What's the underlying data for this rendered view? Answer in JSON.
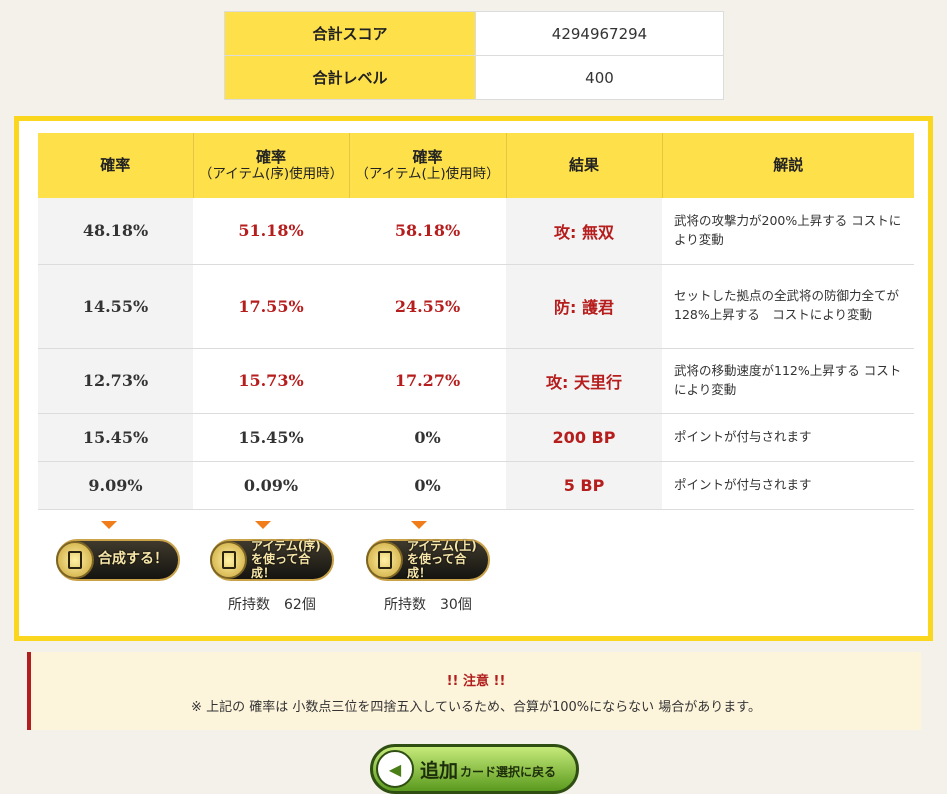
{
  "summary": {
    "rows": [
      {
        "label": "合計スコア",
        "value": "4294967294"
      },
      {
        "label": "合計レベル",
        "value": "400"
      }
    ]
  },
  "table": {
    "headers": {
      "base": "確率",
      "item_low": "確率",
      "item_low_sub": "（アイテム(序)使用時）",
      "item_high": "確率",
      "item_high_sub": "（アイテム(上)使用時）",
      "result": "結果",
      "desc": "解説"
    },
    "rows": [
      {
        "base": "48.18%",
        "low": "51.18%",
        "high": "58.18%",
        "result": "攻: 無双",
        "desc": "武将の攻撃力が200%上昇する コストにより変動"
      },
      {
        "base": "14.55%",
        "low": "17.55%",
        "high": "24.55%",
        "result": "防: 護君",
        "desc": "セットした拠点の全武将の防御力全てが128%上昇する　コストにより変動"
      },
      {
        "base": "12.73%",
        "low": "15.73%",
        "high": "17.27%",
        "result": "攻: 天里行",
        "desc": "武将の移動速度が112%上昇する コストにより変動"
      },
      {
        "base": "15.45%",
        "low": "15.45%",
        "high": "0%",
        "result": "200 BP",
        "desc": "ポイントが付与されます"
      },
      {
        "base": "9.09%",
        "low": "0.09%",
        "high": "0%",
        "result": "5 BP",
        "desc": "ポイントが付与されます"
      }
    ]
  },
  "buttons": {
    "fuse": "合成する！",
    "item_low_l1": "アイテム(序)",
    "item_low_l2": "を使って合成！",
    "item_high_l1": "アイテム(上)",
    "item_high_l2": "を使って合成！",
    "owned_low": "所持数　62個",
    "owned_high": "所持数　30個"
  },
  "notice": {
    "title": "!! 注意 !!",
    "message": "※ 上記の 確率は 小数点三位を四捨五入しているため、合算が100%にならない 場合があります。"
  },
  "back": {
    "label_big": "追加",
    "label_small": "カード選択に戻る"
  },
  "colors": {
    "accent_yellow": "#fee14a",
    "border_yellow": "#fbd61f",
    "result_red": "#b61d1d",
    "notice_red": "#b11e1e"
  },
  "icons": [
    "card-icon",
    "item-card-icon",
    "back-arrow-icon",
    "dropdown-arrow-icon"
  ]
}
